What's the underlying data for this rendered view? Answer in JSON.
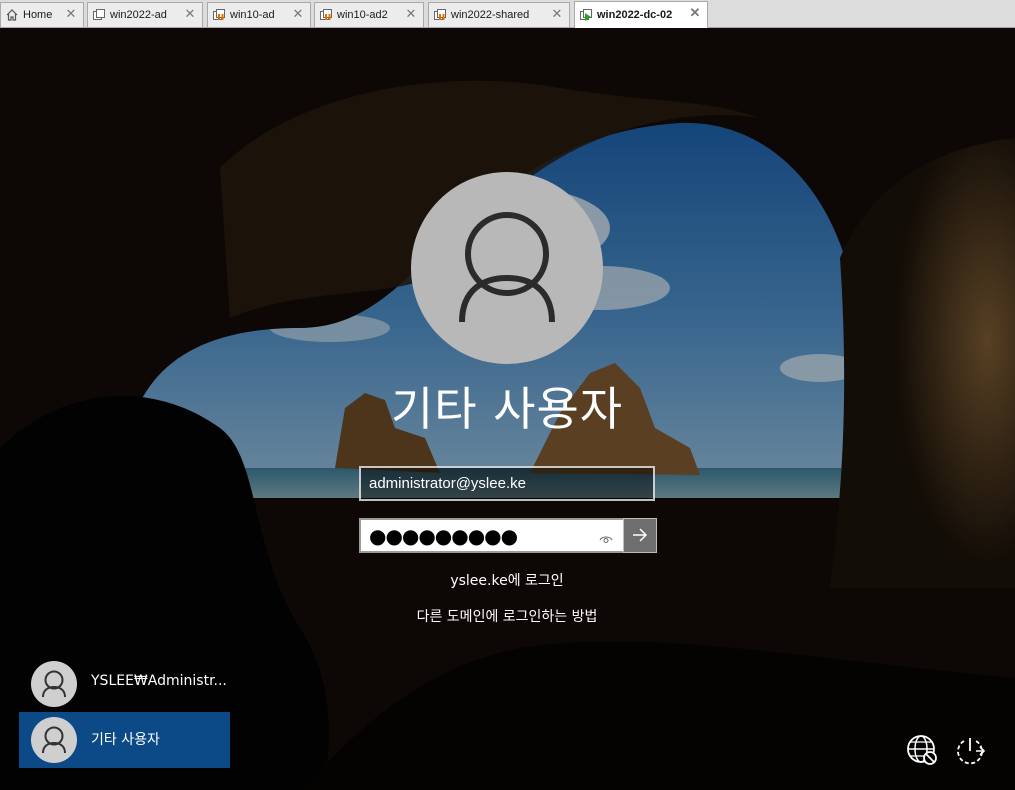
{
  "tabs": [
    {
      "label": "Home",
      "icon": "home-icon",
      "active": false
    },
    {
      "label": "win2022-ad",
      "icon": "vm-icon",
      "active": false
    },
    {
      "label": "win10-ad",
      "icon": "vm-paused-icon",
      "active": false
    },
    {
      "label": "win10-ad2",
      "icon": "vm-paused-icon",
      "active": false
    },
    {
      "label": "win2022-shared",
      "icon": "vm-paused-icon",
      "active": false
    },
    {
      "label": "win2022-dc-02",
      "icon": "vm-running-icon",
      "active": true
    }
  ],
  "login": {
    "display_name": "기타 사용자",
    "username_value": "administrator@yslee.ke",
    "password_masked": "●●●●●●●●●",
    "sign_in_to": "yslee.ke에 로그인",
    "other_domain_link": "다른 도메인에 로그인하는 방법"
  },
  "user_list": [
    {
      "name": "YSLEE₩Administr...",
      "selected": false
    },
    {
      "name": "기타 사용자",
      "selected": true
    }
  ],
  "colors": {
    "selected_user_bg": "#0b4a86",
    "avatar_bg": "#b8b8b8",
    "submit_bg": "#6e6e6e"
  },
  "icons": {
    "network": "network-disconnected-icon",
    "power": "power-icon"
  }
}
